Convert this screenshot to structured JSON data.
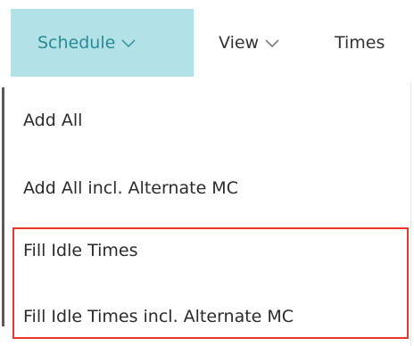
{
  "menubar": {
    "tabs": [
      {
        "label": "Schedule",
        "active": true
      },
      {
        "label": "View",
        "active": false
      },
      {
        "label": "Times",
        "active": false
      }
    ]
  },
  "dropdown": {
    "items": [
      {
        "label": "Add All"
      },
      {
        "label": "Add All incl. Alternate MC"
      },
      {
        "label": "Fill Idle Times"
      },
      {
        "label": "Fill Idle Times incl. Alternate MC"
      }
    ]
  },
  "colors": {
    "active_tab_bg": "#b2e2e8",
    "active_tab_text": "#2a8a95",
    "highlight_border": "#e8362a"
  },
  "icons": [
    "chevron-down-icon"
  ]
}
